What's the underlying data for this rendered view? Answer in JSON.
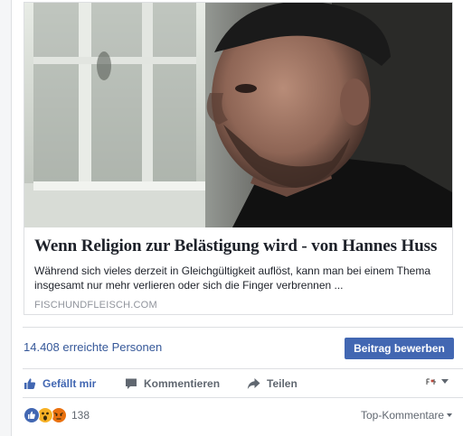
{
  "card": {
    "title": "Wenn Religion zur Belästigung wird - von Hannes Huss",
    "description": "Während sich vieles derzeit in Gleichgültigkeit auflöst, kann man bei einem Thema insgesamt nur mehr verlieren oder sich die Finger verbrennen ...",
    "domain": "FISCHUNDFLEISCH.COM"
  },
  "insights": {
    "reach_count": "14.408",
    "reach_label": "erreichte Personen",
    "boost_label": "Beitrag bewerben"
  },
  "actions": {
    "like_label": "Gefällt mir",
    "comment_label": "Kommentieren",
    "share_label": "Teilen",
    "like_icon": "thumbs-up-icon",
    "comment_icon": "speech-bubble-icon",
    "share_icon": "share-arrow-icon"
  },
  "reactions": {
    "types": [
      "like",
      "wow",
      "angry"
    ],
    "count": "138",
    "sort_label": "Top-Kommentare"
  },
  "colors": {
    "link_blue": "#365899",
    "button_blue": "#4267b2",
    "gray_text": "#606770",
    "like_blue": "#4267b2",
    "wow_yellow": "#f7b125",
    "angry_orange": "#e9710f"
  }
}
